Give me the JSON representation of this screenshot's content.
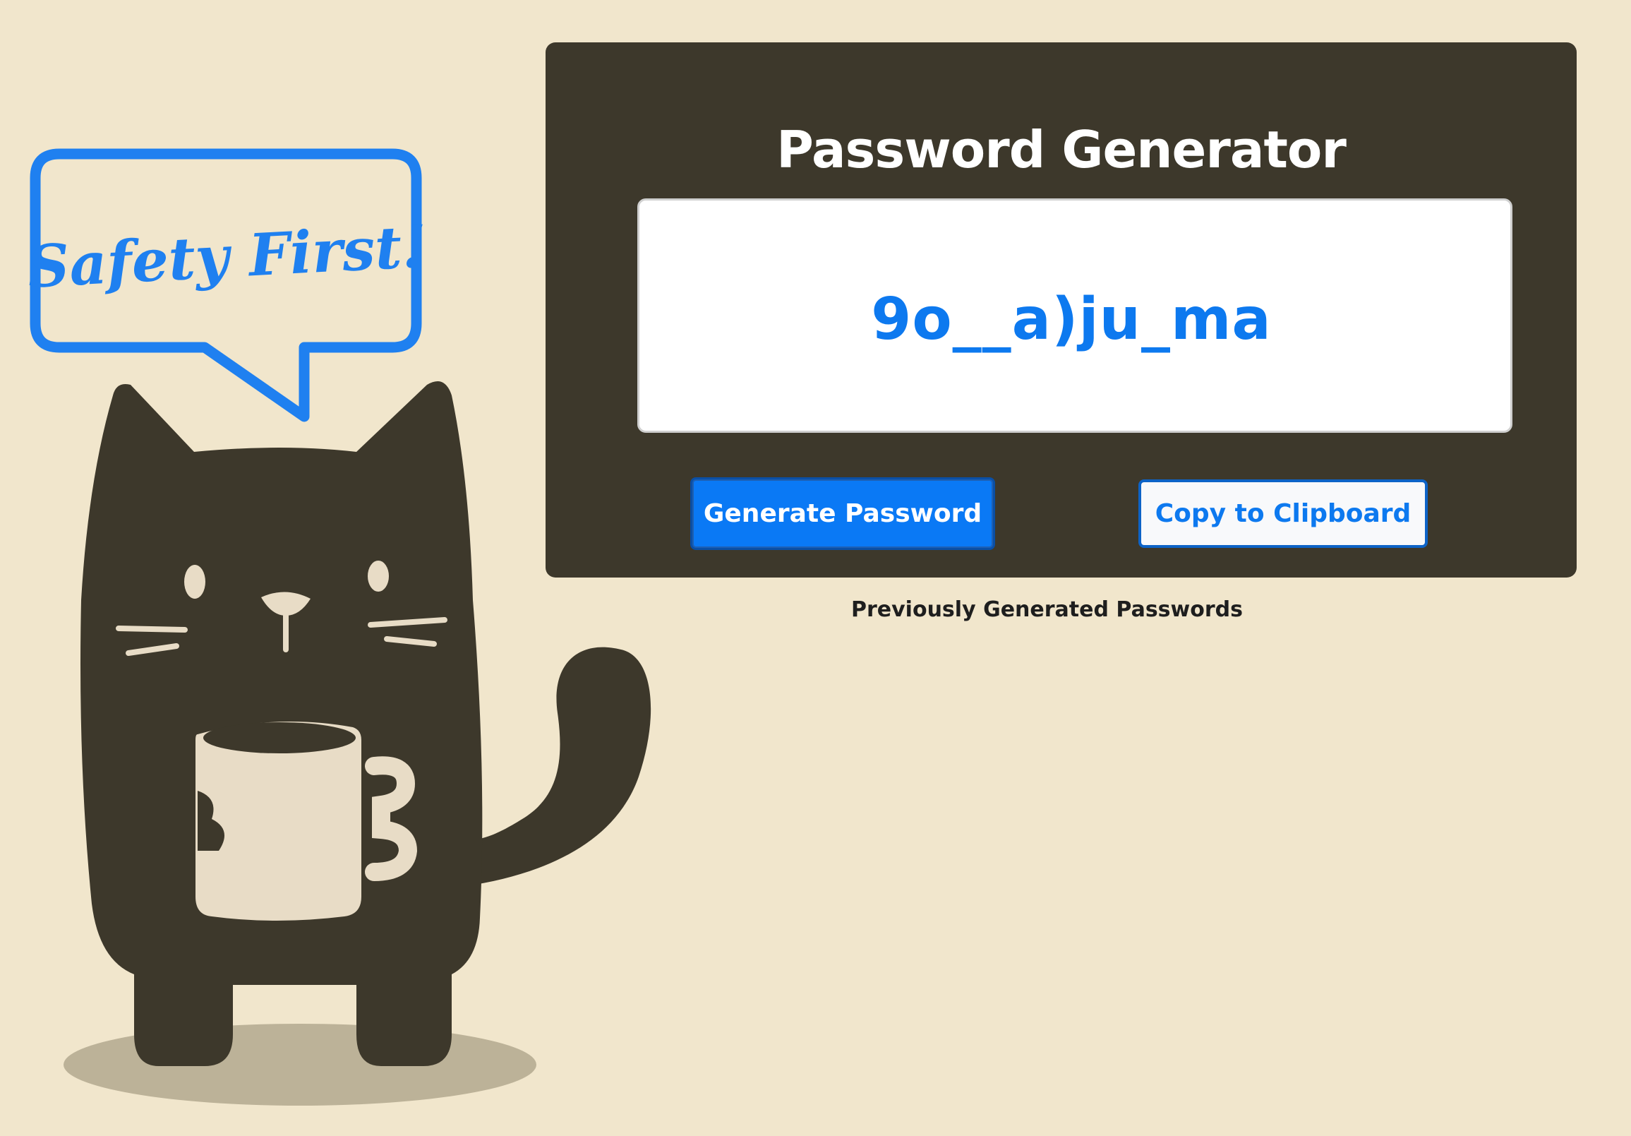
{
  "illustration": {
    "speech_bubble_text": "Safety First!",
    "bubble_color": "#1f80f0",
    "cat_color": "#3d382b",
    "mug_color": "#e8dcc6",
    "shadow_color": "#bcb298"
  },
  "generator": {
    "title": "Password Generator",
    "password": "9o__a)ju_ma",
    "generate_label": "Generate Password",
    "copy_label": "Copy to Clipboard",
    "panel_color": "#3d382b",
    "accent_color": "#0a79f5"
  },
  "history": {
    "label": "Previously Generated Passwords"
  }
}
